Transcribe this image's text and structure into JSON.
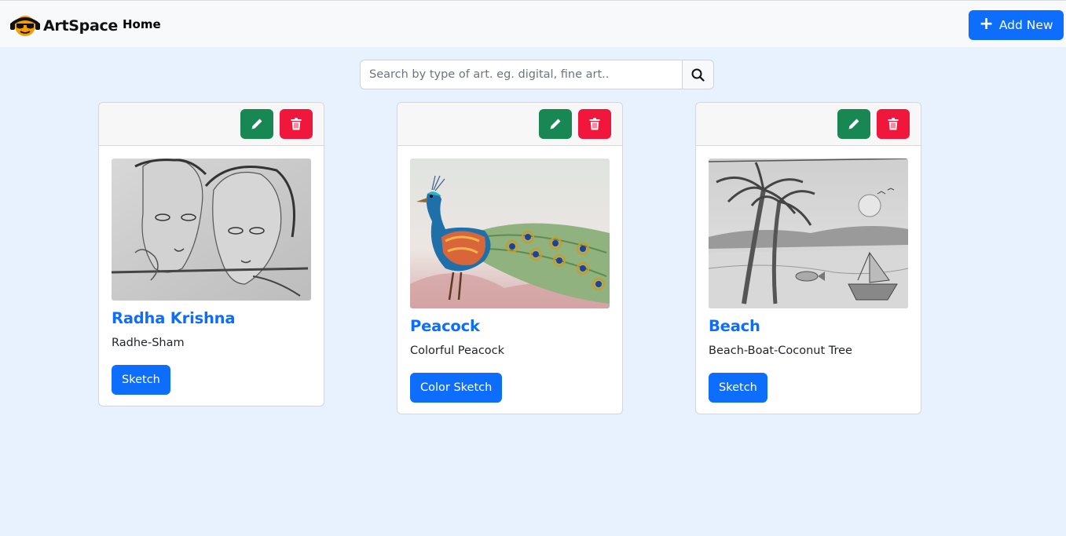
{
  "brand": {
    "name": "ArtSpace",
    "logo_icon": "sunglasses-face-icon"
  },
  "nav": {
    "home_label": "Home"
  },
  "toolbar": {
    "add_label": "Add New"
  },
  "search": {
    "placeholder": "Search by type of art. eg. digital, fine art..",
    "value": ""
  },
  "colors": {
    "accent": "#0d6efd",
    "edit": "#198754",
    "delete": "#f0163c",
    "background": "#e8f1fe"
  },
  "cards": [
    {
      "title": "Radha Krishna",
      "description": "Radhe-Sham",
      "tag": "Sketch",
      "image_icon": "pencil-sketch-portrait-image"
    },
    {
      "title": "Peacock",
      "description": "Colorful Peacock",
      "tag": "Color Sketch",
      "image_icon": "peacock-painting-image"
    },
    {
      "title": "Beach",
      "description": "Beach-Boat-Coconut Tree",
      "tag": "Sketch",
      "image_icon": "beach-sketch-image"
    }
  ]
}
